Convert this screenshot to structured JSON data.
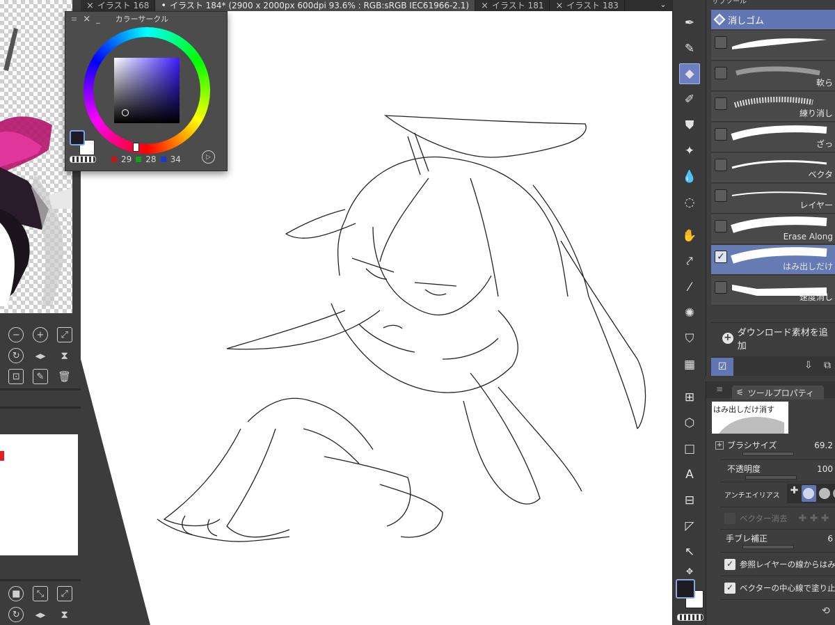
{
  "tabs": [
    {
      "label": "イラスト 168",
      "active": false,
      "marker": "×"
    },
    {
      "label": "イラスト 184* (2900 x 2000px 600dpi 93.6% : RGB:sRGB IEC61966-2.1)",
      "active": true,
      "marker": "•"
    },
    {
      "label": "イラスト 181",
      "active": false,
      "marker": "×"
    },
    {
      "label": "イラスト 183",
      "active": false,
      "marker": "×"
    }
  ],
  "tab_overflow_icon": "chevron-down-icon",
  "color_circle": {
    "title": "カラーサークル",
    "r": "29",
    "g": "28",
    "b": "34",
    "main_color": "#1d1c22",
    "sub_color": "#ffffff"
  },
  "subtool": {
    "header": "サブツール",
    "group": "消しゴム",
    "brushes": [
      {
        "label": "",
        "checked": false,
        "selected": false
      },
      {
        "label": "軟ら",
        "checked": false,
        "selected": false
      },
      {
        "label": "練り消し",
        "checked": false,
        "selected": false
      },
      {
        "label": "ざっ",
        "checked": false,
        "selected": false
      },
      {
        "label": "ベクタ",
        "checked": false,
        "selected": false
      },
      {
        "label": "レイヤー",
        "checked": false,
        "selected": false
      },
      {
        "label": "Erase Along",
        "checked": false,
        "selected": false
      },
      {
        "label": "はみ出しだけ",
        "checked": true,
        "selected": true
      },
      {
        "label": "速度消し",
        "checked": false,
        "selected": false
      }
    ],
    "download": "ダウンロード素材を追加"
  },
  "tool_property": {
    "tab": "ツールプロパティ",
    "preview_name": "はみ出しだけ消す",
    "brush_size_label": "ブラシサイズ",
    "brush_size_value": "69.2",
    "opacity_label": "不透明度",
    "opacity_value": "100",
    "antialias_label": "アンチエイリアス",
    "vector_erase_label": "ベクター消去",
    "stabilization_label": "手ブレ補正",
    "stabilization_value": "6",
    "ref_layer_label": "参照レイヤーの線からはみ出",
    "ref_layer_checked": true,
    "vector_center_label": "ベクターの中心線で塗り止",
    "vector_center_checked": true
  },
  "toolbar": {
    "tools": [
      "pen-nib-icon",
      "pencil-icon",
      "eraser-icon",
      "marker-icon",
      "stamp-icon",
      "sparkle-icon",
      "blend-drop-icon",
      "lasso-icon",
      "hand-icon",
      "bezier-icon",
      "eyedropper-icon",
      "burst-icon",
      "fill-bucket-icon",
      "gradient-icon",
      "perspective-grid-icon",
      "3d-cube-icon",
      "rectangle-icon",
      "text-icon",
      "frame-icon",
      "ruler-icon",
      "object-select-icon",
      "move-icon"
    ],
    "active_tool": "eraser-icon"
  },
  "accent": "#6176b2"
}
